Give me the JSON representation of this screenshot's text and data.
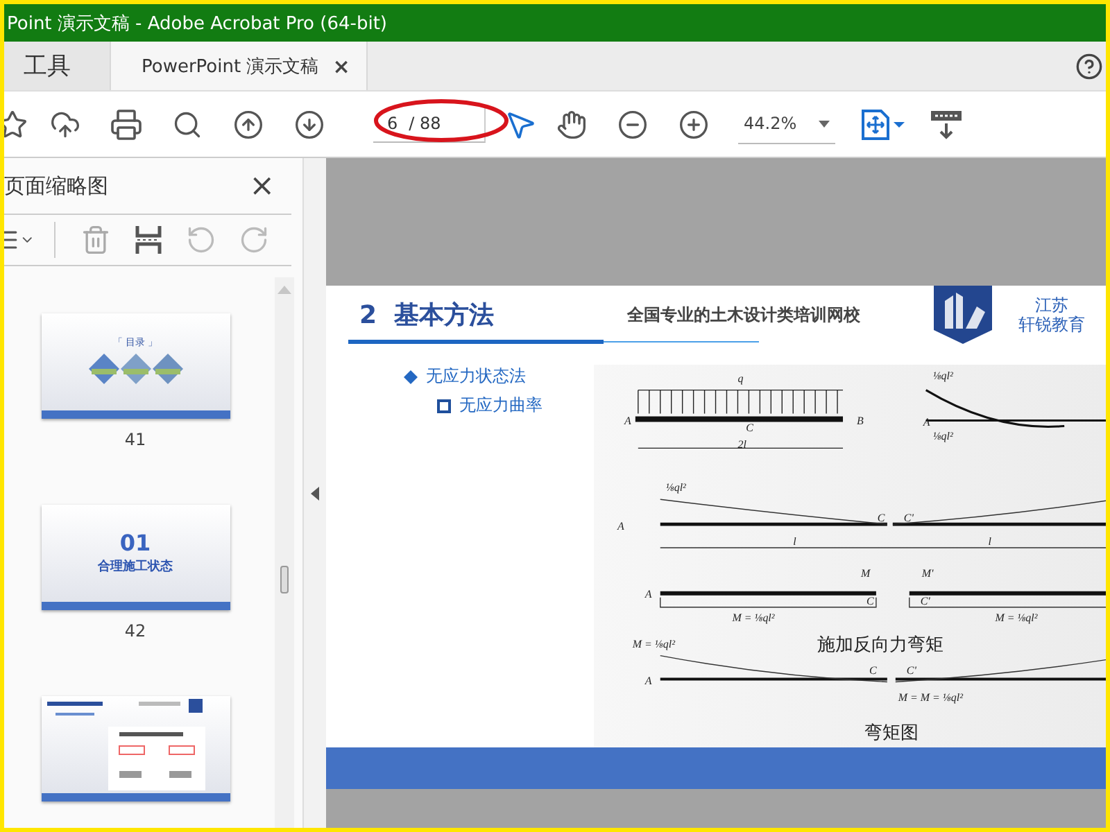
{
  "window": {
    "title": "Point 演示文稿 - Adobe Acrobat Pro (64-bit)"
  },
  "tabs": [
    {
      "label": "工具",
      "selected": false
    },
    {
      "label": "PowerPoint 演示文稿",
      "selected": true,
      "close": "×"
    }
  ],
  "toolbar": {
    "page_current": "6",
    "page_total": "/ 88",
    "zoom": "44.2%"
  },
  "sidebar": {
    "title": "页面缩略图",
    "close": "×",
    "thumbnails": [
      {
        "kind": "contents",
        "heading": "「 目录 」",
        "page": "41"
      },
      {
        "kind": "section",
        "number": "01",
        "heading": "合理施工状态",
        "page": "42"
      },
      {
        "kind": "content"
      }
    ]
  },
  "slide": {
    "heading": "2  基本方法",
    "tagline": "全国专业的土木设计类培训网校",
    "logo_lines": [
      "江苏",
      "轩锐教育"
    ],
    "bullets": [
      {
        "kind": "diamond",
        "text": "无应力状态法"
      },
      {
        "kind": "square",
        "text": "无应力曲率"
      }
    ],
    "diagram": {
      "labels": [
        "q",
        "A",
        "B",
        "C",
        "2l",
        "⅛ql²",
        "A",
        "⅛ql²",
        "⅛ql²",
        "A",
        "C",
        "C'",
        "l",
        "l",
        "M",
        "M'",
        "A",
        "C",
        "C'",
        "M = ⅛ql²",
        "M = ⅛ql²",
        "M = ⅛ql²",
        "A",
        "C",
        "C'",
        "M = M = ⅛ql²"
      ],
      "captions": [
        "施加反向力弯矩",
        "弯矩图"
      ]
    }
  }
}
